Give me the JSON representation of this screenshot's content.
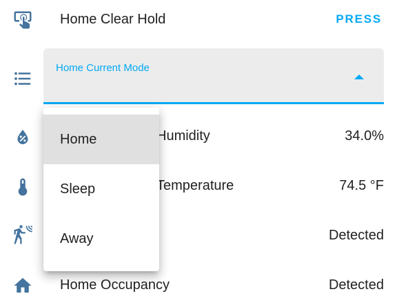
{
  "rows": {
    "clear_hold": {
      "label": "Home Clear Hold",
      "action": "PRESS",
      "icon": "gesture-tap-button-icon"
    },
    "current_mode": {
      "label": "Home Current Mode",
      "icon": "format-list-bulleted-icon"
    },
    "humidity": {
      "label": "Home Humidity",
      "visible_label": "Humidity",
      "value": "34.0%",
      "icon": "water-percent-icon"
    },
    "temperature": {
      "label": "Home Temperature",
      "visible_label": "Temperature",
      "value": "74.5 °F",
      "icon": "thermometer-icon"
    },
    "motion": {
      "value": "Detected",
      "icon": "motion-sensor-icon"
    },
    "occupancy": {
      "label": "Home Occupancy",
      "value": "Detected",
      "icon": "home-icon"
    }
  },
  "dropdown": {
    "options": [
      "Home",
      "Sleep",
      "Away"
    ],
    "selected": "Home"
  },
  "colors": {
    "accent": "#03a9f4",
    "icon": "#44739e",
    "text": "#212121",
    "field_bg": "#ececec",
    "selected_bg": "#e0e0e0"
  }
}
